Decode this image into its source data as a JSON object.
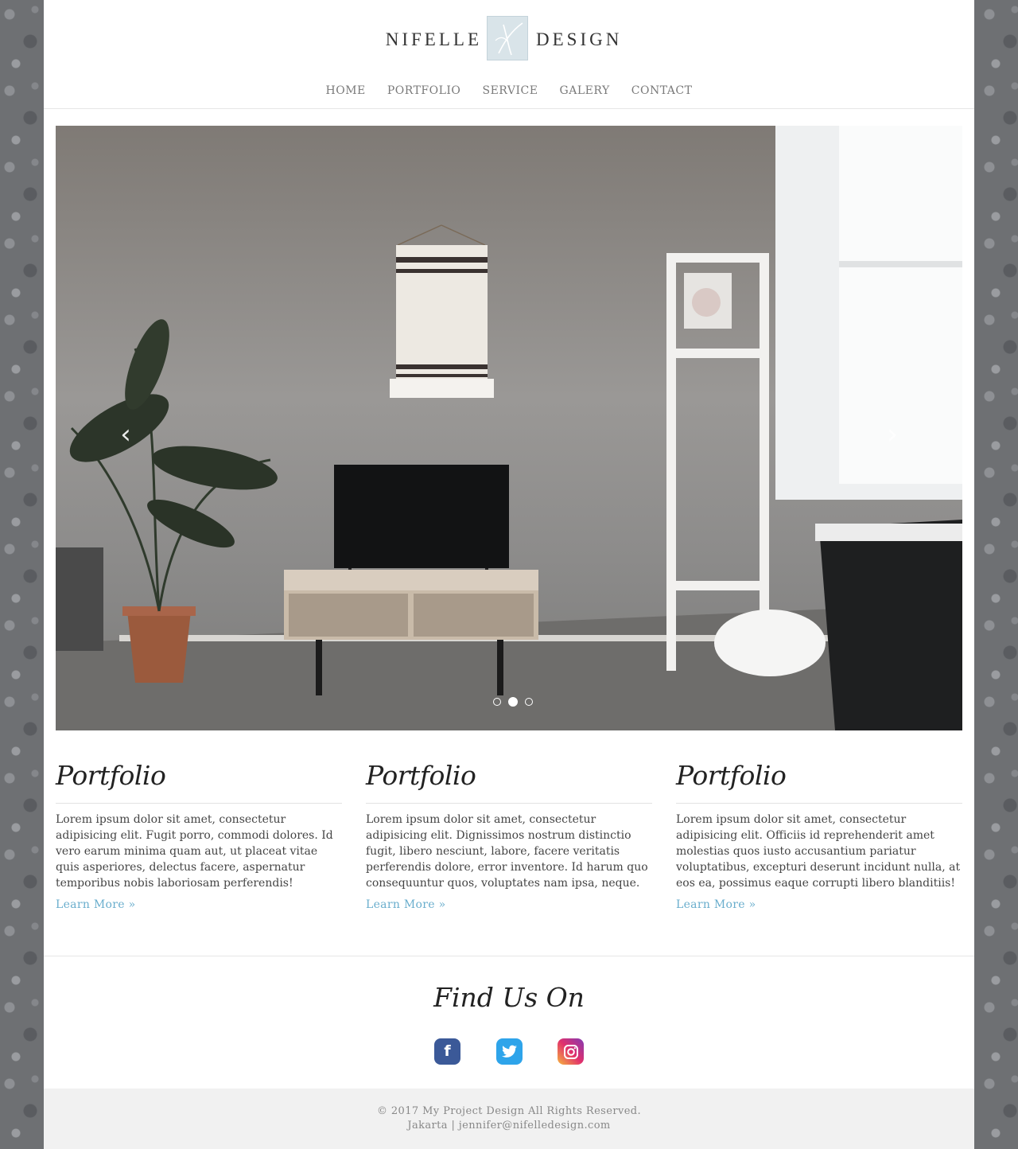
{
  "logo": {
    "left_word": "NIFELLE",
    "right_word": "DESIGN"
  },
  "nav": [
    "HOME",
    "PORTFOLIO",
    "SERVICE",
    "GALERY",
    "CONTACT"
  ],
  "hero": {
    "prev_icon": "chevron-left-icon",
    "next_icon": "chevron-right-icon",
    "slide_count": 3,
    "active_slide": 2
  },
  "columns": [
    {
      "title": "Portfolio",
      "text": "Lorem ipsum dolor sit amet, consectetur adipisicing elit. Fugit porro, commodi dolores. Id vero earum minima quam aut, ut placeat vitae quis asperiores, delectus facere, aspernatur temporibus nobis laboriosam perferendis!",
      "link": "Learn More »"
    },
    {
      "title": "Portfolio",
      "text": "Lorem ipsum dolor sit amet, consectetur adipisicing elit. Dignissimos nostrum distinctio fugit, libero nesciunt, labore, facere veritatis perferendis dolore, error inventore. Id harum quo consequuntur quos, voluptates nam ipsa, neque.",
      "link": "Learn More »"
    },
    {
      "title": "Portfolio",
      "text": "Lorem ipsum dolor sit amet, consectetur adipisicing elit. Officiis id reprehenderit amet molestias quos iusto accusantium pariatur voluptatibus, excepturi deserunt incidunt nulla, at eos ea, possimus eaque corrupti libero blanditiis!",
      "link": "Learn More »"
    }
  ],
  "find_us": {
    "title": "Find Us On",
    "social": [
      {
        "name": "facebook",
        "icon": "facebook-icon",
        "glyph": "f",
        "color": "#3b5998"
      },
      {
        "name": "twitter",
        "icon": "twitter-icon",
        "glyph": "t",
        "color": "#2ea4ea"
      },
      {
        "name": "instagram",
        "icon": "instagram-icon",
        "glyph": "◎",
        "color": "#e1306c"
      }
    ]
  },
  "footer": {
    "copyright": "© 2017 My Project Design All Rights Reserved.",
    "contact": "Jakarta | jennifer@nifelledesign.com"
  },
  "colors": {
    "link": "#6aaecd",
    "background_pattern": "#6e7073",
    "footer_bg": "#f1f1f1"
  }
}
